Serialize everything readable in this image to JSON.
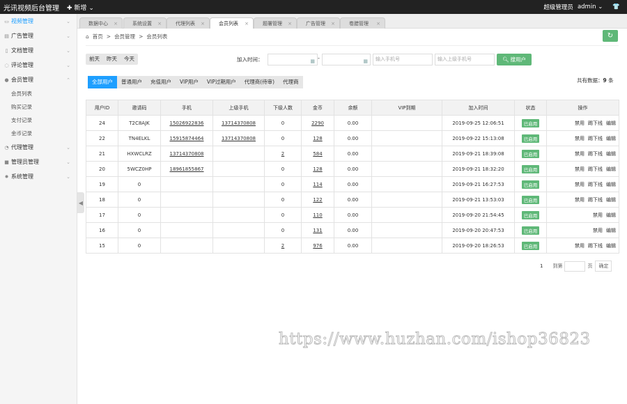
{
  "header": {
    "brand": "光讯视频后台管理",
    "new_label": "新增",
    "role": "超级管理员",
    "user": "admin"
  },
  "sidebar": {
    "items": [
      {
        "label": "视频管理",
        "icon": "video-icon"
      },
      {
        "label": "广告管理",
        "icon": "ad-icon"
      },
      {
        "label": "文档管理",
        "icon": "doc-icon"
      },
      {
        "label": "评论管理",
        "icon": "comment-icon"
      },
      {
        "label": "会员管理",
        "icon": "user-icon"
      },
      {
        "label": "代理管理",
        "icon": "agent-icon"
      },
      {
        "label": "管理员管理",
        "icon": "admin-icon"
      },
      {
        "label": "系统管理",
        "icon": "gear-icon"
      }
    ],
    "sub": [
      "会员列表",
      "购买记录",
      "支付记录",
      "金币记录"
    ]
  },
  "tabs": [
    "数据中心",
    "系统设置",
    "代理列表",
    "会员列表",
    "题署管理",
    "广告管理",
    "卷腊管理"
  ],
  "breadcrumb": [
    "首页",
    ">",
    "会员管理",
    ">",
    "会员列表"
  ],
  "toolbar": {
    "date_buttons": [
      "前天",
      "昨天",
      "今天"
    ],
    "join_label": "加入时间：",
    "dash": "-",
    "phone_placeholder": "输入手机号",
    "parent_phone_placeholder": "输入上级手机号",
    "search_label": "搜用户"
  },
  "filters": [
    "全部用户",
    "普通用户",
    "充值用户",
    "VIP用户",
    "VIP过期用户",
    "代理商(待审)",
    "代理商"
  ],
  "total": {
    "label": "共有数据：",
    "count": "9",
    "unit": "条"
  },
  "table": {
    "headers": [
      "用户ID",
      "邀请码",
      "手机",
      "上级手机",
      "下级人数",
      "金币",
      "余额",
      "VIP到期",
      "加入时间",
      "状态",
      "操作"
    ],
    "rows": [
      {
        "id": "24",
        "code": "T2C8AJK",
        "phone": "15026922836",
        "parent": "13714370808",
        "sub": "0",
        "coin": "2290",
        "balance": "0.00",
        "vip": "",
        "time": "2019-09-25 12:06:51",
        "status": "已启用",
        "ops": [
          "禁用",
          "踢下线",
          "编辑"
        ]
      },
      {
        "id": "22",
        "code": "TN4ELKL",
        "phone": "15915874464",
        "parent": "13714370808",
        "sub": "0",
        "coin": "128",
        "balance": "0.00",
        "vip": "",
        "time": "2019-09-22 15:13:08",
        "status": "已启用",
        "ops": [
          "禁用",
          "踢下线",
          "编辑"
        ]
      },
      {
        "id": "21",
        "code": "HXWCLRZ",
        "phone": "13714370808",
        "parent": "",
        "sub": "2",
        "coin": "584",
        "balance": "0.00",
        "vip": "",
        "time": "2019-09-21 18:39:08",
        "status": "已启用",
        "ops": [
          "禁用",
          "踢下线",
          "编辑"
        ]
      },
      {
        "id": "20",
        "code": "5WCZ0HP",
        "phone": "18961855867",
        "parent": "",
        "sub": "0",
        "coin": "128",
        "balance": "0.00",
        "vip": "",
        "time": "2019-09-21 18:32:20",
        "status": "已启用",
        "ops": [
          "禁用",
          "踢下线",
          "编辑"
        ]
      },
      {
        "id": "19",
        "code": "0",
        "phone": "",
        "parent": "",
        "sub": "0",
        "coin": "114",
        "balance": "0.00",
        "vip": "",
        "time": "2019-09-21 16:27:53",
        "status": "已启用",
        "ops": [
          "禁用",
          "踢下线",
          "编辑"
        ]
      },
      {
        "id": "18",
        "code": "0",
        "phone": "",
        "parent": "",
        "sub": "0",
        "coin": "122",
        "balance": "0.00",
        "vip": "",
        "time": "2019-09-21 13:53:03",
        "status": "已启用",
        "ops": [
          "禁用",
          "踢下线",
          "编辑"
        ]
      },
      {
        "id": "17",
        "code": "0",
        "phone": "",
        "parent": "",
        "sub": "0",
        "coin": "110",
        "balance": "0.00",
        "vip": "",
        "time": "2019-09-20 21:54:45",
        "status": "已启用",
        "ops": [
          "禁用",
          "编辑"
        ]
      },
      {
        "id": "16",
        "code": "0",
        "phone": "",
        "parent": "",
        "sub": "0",
        "coin": "131",
        "balance": "0.00",
        "vip": "",
        "time": "2019-09-20 20:47:53",
        "status": "已启用",
        "ops": [
          "禁用",
          "编辑"
        ]
      },
      {
        "id": "15",
        "code": "0",
        "phone": "",
        "parent": "",
        "sub": "2",
        "coin": "976",
        "balance": "0.00",
        "vip": "",
        "time": "2019-09-20 18:26:53",
        "status": "已启用",
        "ops": [
          "禁用",
          "踢下线",
          "编辑"
        ]
      }
    ]
  },
  "pager": {
    "page": "1",
    "goto_label": "到第",
    "page_unit": "页",
    "confirm": "确定"
  },
  "watermark": "https://www.huzhan.com/ishop36823",
  "colors": {
    "accent": "#1E9FFF",
    "green": "#5FB878"
  }
}
